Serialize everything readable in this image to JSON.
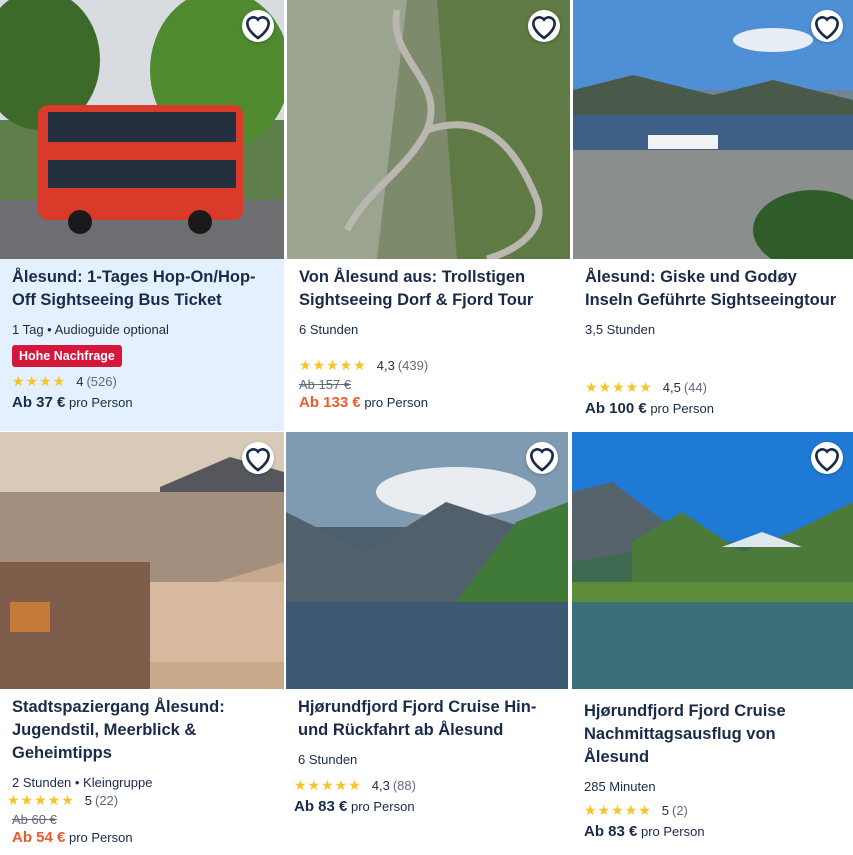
{
  "cards": [
    {
      "title": "Ålesund: 1-Tages Hop-On/Hop-Off Sightseeing Bus Ticket",
      "meta": "1 Tag • Audioguide optional",
      "badge": "Hohe Nachfrage",
      "stars": "★★★★",
      "rating": "4",
      "reviews": "(526)",
      "price": "Ab 37 €",
      "per": "pro Person"
    },
    {
      "title": "Von Ålesund aus: Trollstigen Sightseeing Dorf & Fjord Tour",
      "meta": "6 Stunden",
      "stars": "★★★★★",
      "rating": "4,3",
      "reviews": "(439)",
      "old_price": "Ab 157 €",
      "price": "Ab 133 €",
      "per": "pro Person"
    },
    {
      "title": "Ålesund: Giske und Godøy Inseln Geführte Sightseeingtour",
      "meta": "3,5 Stunden",
      "stars": "★★★★★",
      "rating": "4,5",
      "reviews": "(44)",
      "price": "Ab 100 €",
      "per": "pro Person"
    },
    {
      "title": "Stadtspaziergang Ålesund: Jugendstil, Meerblick & Geheimtipps",
      "meta": "2 Stunden • Kleingruppe",
      "stars": "★★★★★",
      "rating": "5",
      "reviews": "(22)",
      "old_price": "Ab 60 €",
      "price": "Ab 54 €",
      "per": "pro Person"
    },
    {
      "title": "Hjørundfjord Fjord Cruise Hin- und Rückfahrt ab Ålesund",
      "meta": "6 Stunden",
      "stars": "★★★★★",
      "rating": "4,3",
      "reviews": "(88)",
      "price": "Ab 83 €",
      "per": "pro Person"
    },
    {
      "title": "Hjørundfjord Fjord Cruise Nachmittagsausflug von Ålesund",
      "meta": "285 Minuten",
      "stars": "★★★★★",
      "rating": "5",
      "reviews": "(2)",
      "price": "Ab 83 €",
      "per": "pro Person"
    }
  ],
  "colors": {
    "brand": "#1a2b49",
    "badge": "#d6173c",
    "sale": "#eb5b2b",
    "star": "#f7c325",
    "highlight": "#e4f0fd"
  },
  "icons": {
    "wishlist": "heart-outline-icon",
    "rating": "star-icon"
  }
}
